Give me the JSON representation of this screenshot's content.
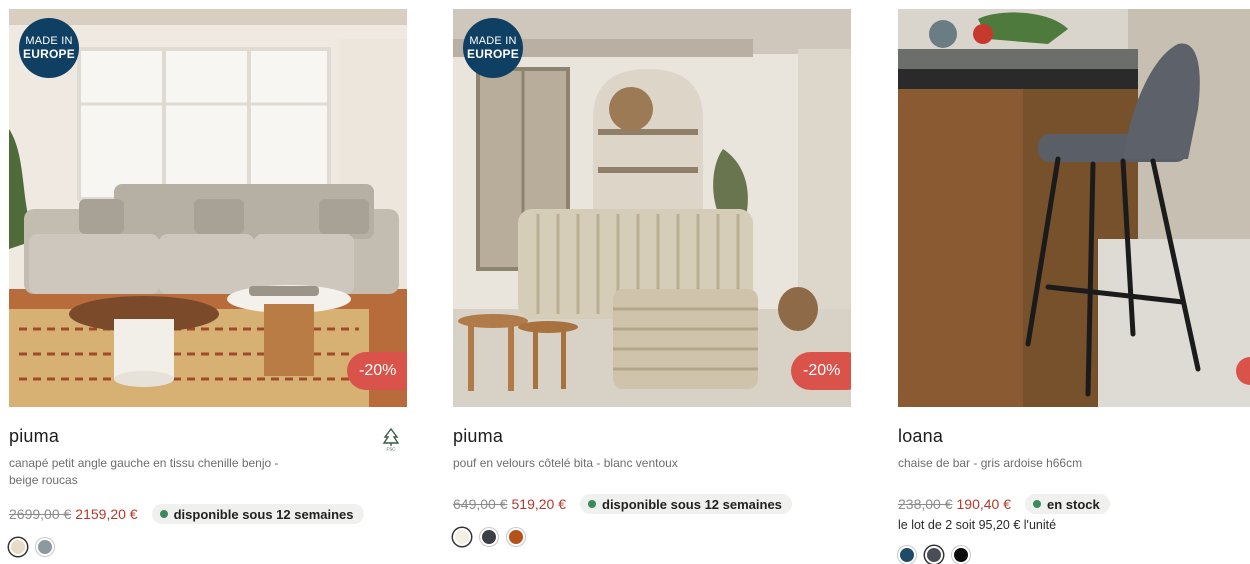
{
  "products": [
    {
      "badge_made": [
        "MADE IN",
        "EUROPE"
      ],
      "discount": "-20%",
      "name": "piuma",
      "description": "canapé petit angle gauche en tissu chenille benjo - beige roucas",
      "fsc_icon": "fsc-tree-icon",
      "old_price": "2699,00 €",
      "new_price": "2159,20 €",
      "availability": "disponible sous 12 semaines",
      "swatches": [
        "#e7dcc8",
        "#8c9aa0"
      ]
    },
    {
      "badge_made": [
        "MADE IN",
        "EUROPE"
      ],
      "discount": "-20%",
      "name": "piuma",
      "description": "pouf en velours côtelé bita - blanc ventoux",
      "old_price": "649,00 €",
      "new_price": "519,20 €",
      "availability": "disponible sous 12 semaines",
      "swatches": [
        "#f3efe3",
        "#3c3f48",
        "#b4521a"
      ]
    },
    {
      "name": "loana",
      "description": "chaise de bar - gris ardoise h66cm",
      "old_price": "238,00 €",
      "new_price": "190,40 €",
      "availability": "en stock",
      "lot_note": "le lot de 2 soit 95,20 € l'unité",
      "swatches": [
        "#1f4b66",
        "#4a4d55",
        "#0c0c0c"
      ]
    }
  ],
  "colors": {
    "accent_red": "#d9534a",
    "price_red": "#b23a2e",
    "badge_blue": "#0f3f63",
    "status_green": "#3a8a5b"
  }
}
